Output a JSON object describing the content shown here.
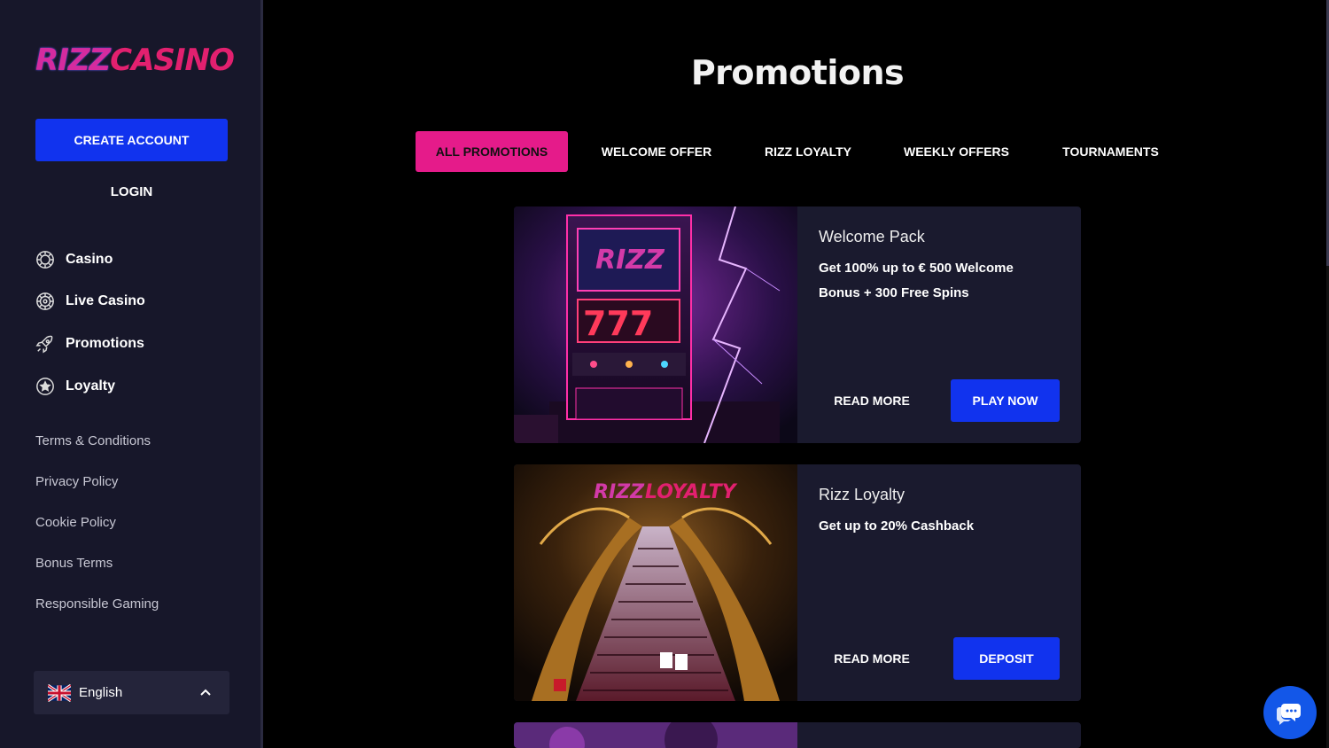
{
  "brand": {
    "logo_part1": "RIZZ",
    "logo_part2": "CASINO"
  },
  "sidebar": {
    "create_account": "CREATE ACCOUNT",
    "login": "LOGIN",
    "nav": [
      {
        "label": "Casino",
        "icon": "casino-chip-icon"
      },
      {
        "label": "Live Casino",
        "icon": "roulette-icon"
      },
      {
        "label": "Promotions",
        "icon": "rocket-icon"
      },
      {
        "label": "Loyalty",
        "icon": "star-circle-icon"
      }
    ],
    "links": [
      "Terms & Conditions",
      "Privacy Policy",
      "Cookie Policy",
      "Bonus Terms",
      "Responsible Gaming"
    ],
    "language": "English"
  },
  "main": {
    "title": "Promotions",
    "tabs": [
      "ALL PROMOTIONS",
      "WELCOME OFFER",
      "RIZZ LOYALTY",
      "WEEKLY OFFERS",
      "TOURNAMENTS"
    ],
    "cards": [
      {
        "title": "Welcome Pack",
        "description": "Get 100% up to € 500 Welcome Bonus + 300 Free Spins",
        "read_more": "READ MORE",
        "action": "PLAY NOW",
        "image_text": "RIZZ"
      },
      {
        "title": "Rizz Loyalty",
        "description": "Get up to 20% Cashback",
        "read_more": "READ MORE",
        "action": "DEPOSIT",
        "image_text_1": "RIZZ",
        "image_text_2": "LOYALTY"
      }
    ]
  },
  "colors": {
    "accent_pink": "#e51b8a",
    "primary_blue": "#1133ee",
    "sidebar_bg": "#17172a",
    "card_bg": "#1a1a2e"
  }
}
